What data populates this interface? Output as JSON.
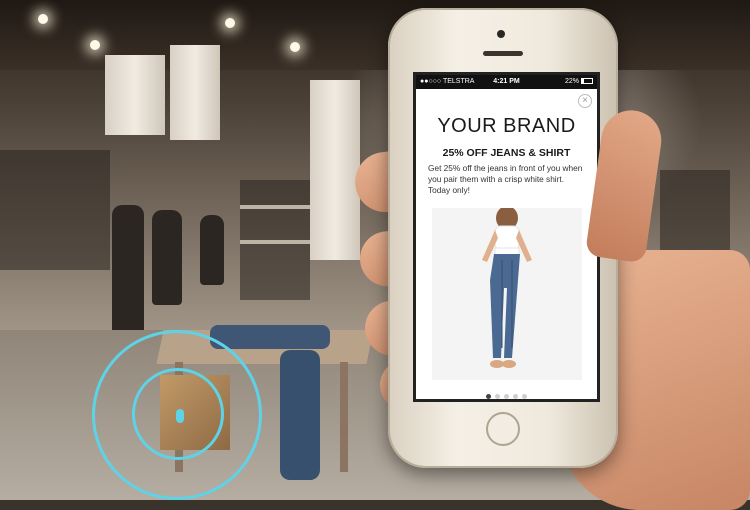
{
  "status_bar": {
    "carrier": "●●○○○ TELSTRA",
    "time": "4:21 PM",
    "battery": "22%"
  },
  "notification": {
    "brand": "YOUR BRAND",
    "title": "25% OFF JEANS & SHIRT",
    "description": "Get 25% off the jeans in front of you when you pair them with a crisp white shirt. Today only!",
    "close_icon": "close-icon",
    "product_image": "woman-in-jeans-and-white-shirt",
    "pagination": {
      "count": 5,
      "active_index": 0
    }
  },
  "colors": {
    "beacon_ring": "#5ed3e8",
    "screen_bg": "#ffffff",
    "status_bar_bg": "#111111",
    "phone_body": "#efe9dd"
  }
}
